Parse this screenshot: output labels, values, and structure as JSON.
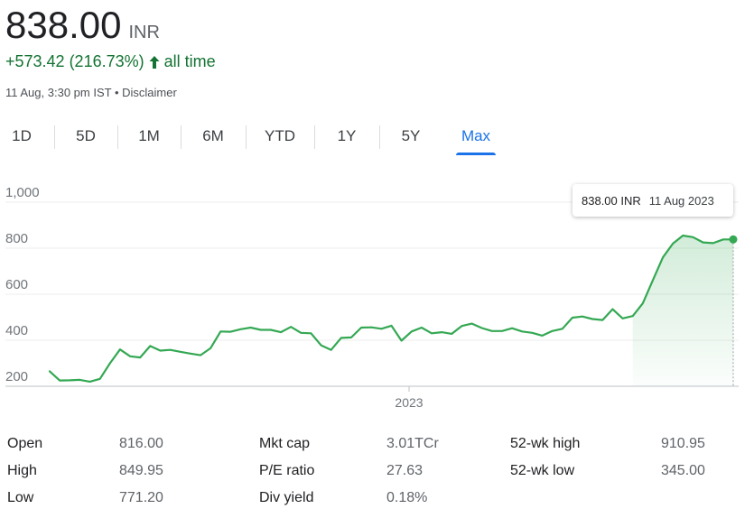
{
  "quote": {
    "price": "838.00",
    "currency": "INR",
    "change": "+573.42 (216.73%)",
    "change_period": "all time",
    "timestamp": "11 Aug, 3:30 pm IST",
    "separator": "•",
    "disclaimer": "Disclaimer",
    "change_color": "#137333"
  },
  "ranges": [
    "1D",
    "5D",
    "1M",
    "6M",
    "YTD",
    "1Y",
    "5Y",
    "Max"
  ],
  "active_range": "Max",
  "tooltip": {
    "value": "838.00 INR",
    "date": "11 Aug 2023"
  },
  "chart_data": {
    "type": "area",
    "y_ticks": [
      "1,000",
      "800",
      "600",
      "400",
      "200"
    ],
    "y_tick_values": [
      1000,
      800,
      600,
      400,
      200
    ],
    "ylim": [
      200,
      1000
    ],
    "x_tick_labels": [
      "2023"
    ],
    "grid": true,
    "line_color": "#34a853",
    "series": [
      {
        "values": [
          265,
          225,
          226,
          228,
          220,
          232,
          300,
          360,
          330,
          325,
          375,
          355,
          358,
          350,
          342,
          335,
          365,
          438,
          437,
          448,
          455,
          445,
          445,
          435,
          458,
          432,
          430,
          378,
          358,
          410,
          412,
          455,
          456,
          450,
          463,
          398,
          438,
          455,
          430,
          435,
          428,
          462,
          472,
          453,
          440,
          440,
          452,
          438,
          432,
          420,
          440,
          450,
          498,
          503,
          492,
          488,
          535,
          495,
          505,
          560,
          660,
          760,
          820,
          855,
          848,
          825,
          822,
          838,
          838
        ]
      }
    ]
  },
  "stats": [
    {
      "label": "Open",
      "value": "816.00"
    },
    {
      "label": "High",
      "value": "849.95"
    },
    {
      "label": "Low",
      "value": "771.20"
    },
    {
      "label": "Mkt cap",
      "value": "3.01TCr"
    },
    {
      "label": "P/E ratio",
      "value": "27.63"
    },
    {
      "label": "Div yield",
      "value": "0.18%"
    },
    {
      "label": "52-wk high",
      "value": "910.95"
    },
    {
      "label": "52-wk low",
      "value": "345.00"
    }
  ]
}
